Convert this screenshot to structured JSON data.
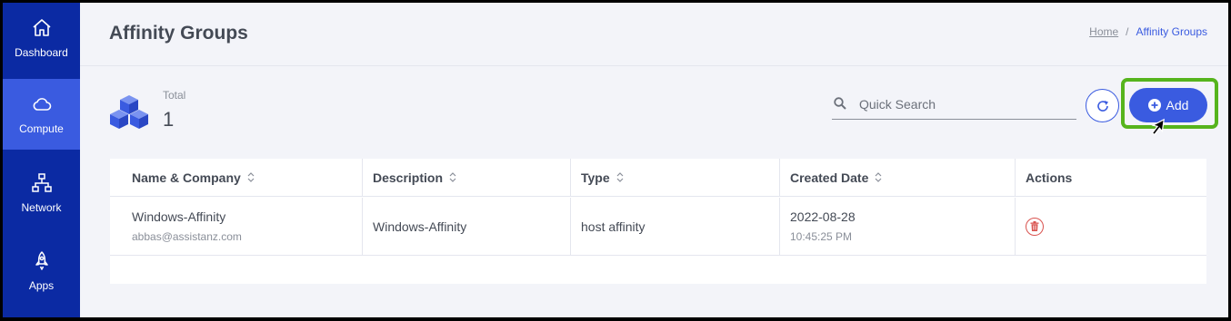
{
  "sidebar": {
    "items": [
      {
        "label": "Dashboard",
        "icon": "home-icon"
      },
      {
        "label": "Compute",
        "icon": "cloud-icon",
        "active": true
      },
      {
        "label": "Network",
        "icon": "network-icon"
      },
      {
        "label": "Apps",
        "icon": "rocket-icon"
      }
    ]
  },
  "header": {
    "title": "Affinity Groups",
    "breadcrumb": {
      "home": "Home",
      "separator": "/",
      "current": "Affinity Groups"
    }
  },
  "summary": {
    "label": "Total",
    "value": "1"
  },
  "search": {
    "placeholder": "Quick Search",
    "value": ""
  },
  "toolbar": {
    "add_label": "Add"
  },
  "table": {
    "columns": [
      {
        "label": "Name & Company",
        "sortable": true
      },
      {
        "label": "Description",
        "sortable": true
      },
      {
        "label": "Type",
        "sortable": true
      },
      {
        "label": "Created Date",
        "sortable": true
      },
      {
        "label": "Actions",
        "sortable": false
      }
    ],
    "rows": [
      {
        "name": "Windows-Affinity",
        "company": "abbas@assistanz.com",
        "description": "Windows-Affinity",
        "type": "host affinity",
        "date": "2022-08-28",
        "time": "10:45:25 PM"
      }
    ]
  },
  "colors": {
    "sidebar": "#0b2aa3",
    "active": "#3a5be0",
    "accent": "#3a5be0",
    "highlight": "#56b41d",
    "danger": "#d9534f"
  }
}
